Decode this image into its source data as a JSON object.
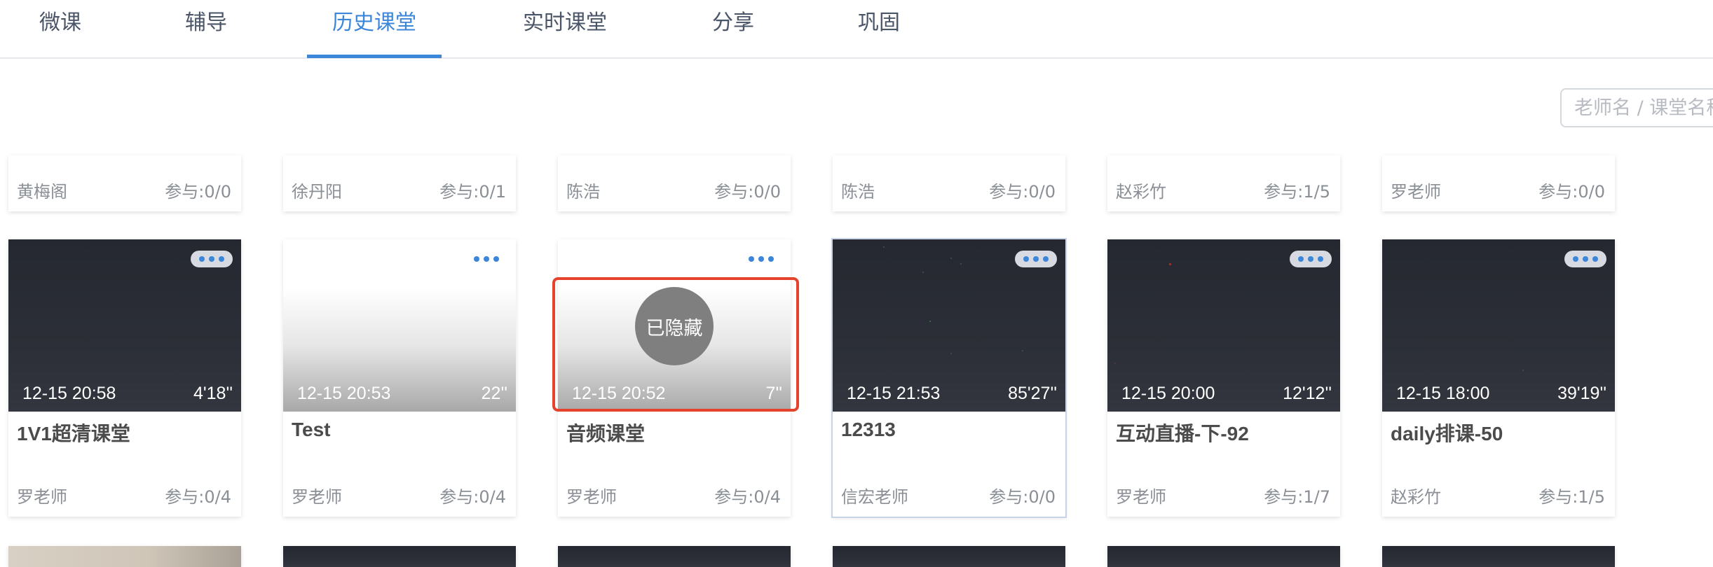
{
  "tabs": [
    {
      "label": "微课",
      "active": false
    },
    {
      "label": "辅导",
      "active": false
    },
    {
      "label": "历史课堂",
      "active": true
    },
    {
      "label": "实时课堂",
      "active": false
    },
    {
      "label": "分享",
      "active": false
    },
    {
      "label": "巩固",
      "active": false
    }
  ],
  "colors": {
    "accent": "#3b86d8",
    "highlight": "#e5432d",
    "text_muted": "#8a8f96"
  },
  "search": {
    "placeholder": "老师名 / 课堂名称"
  },
  "row0": [
    {
      "teacher": "黄梅阁",
      "count": "参与:0/0"
    },
    {
      "teacher": "徐丹阳",
      "count": "参与:0/1"
    },
    {
      "teacher": "陈浩",
      "count": "参与:0/0"
    },
    {
      "teacher": "陈浩",
      "count": "参与:0/0"
    },
    {
      "teacher": "赵彩竹",
      "count": "参与:1/5"
    },
    {
      "teacher": "罗老师",
      "count": "参与:0/0"
    }
  ],
  "row1": [
    {
      "title": "1V1超清课堂",
      "time": "12-15 20:58",
      "duration": "4'18''",
      "teacher": "罗老师",
      "count": "参与:0/4"
    },
    {
      "title": "Test",
      "time": "12-15 20:53",
      "duration": "22''",
      "teacher": "罗老师",
      "count": "参与:0/4"
    },
    {
      "title": "音频课堂",
      "time": "12-15 20:52",
      "duration": "7''",
      "teacher": "罗老师",
      "count": "参与:0/4",
      "badge": "已隐藏"
    },
    {
      "title": "12313",
      "time": "12-15 21:53",
      "duration": "85'27''",
      "teacher": "信宏老师",
      "count": "参与:0/0"
    },
    {
      "title": "互动直播-下-92",
      "time": "12-15 20:00",
      "duration": "12'12''",
      "teacher": "罗老师",
      "count": "参与:1/7"
    },
    {
      "title": "daily排课-50",
      "time": "12-15 18:00",
      "duration": "39'19''",
      "teacher": "赵彩竹",
      "count": "参与:1/5"
    }
  ]
}
